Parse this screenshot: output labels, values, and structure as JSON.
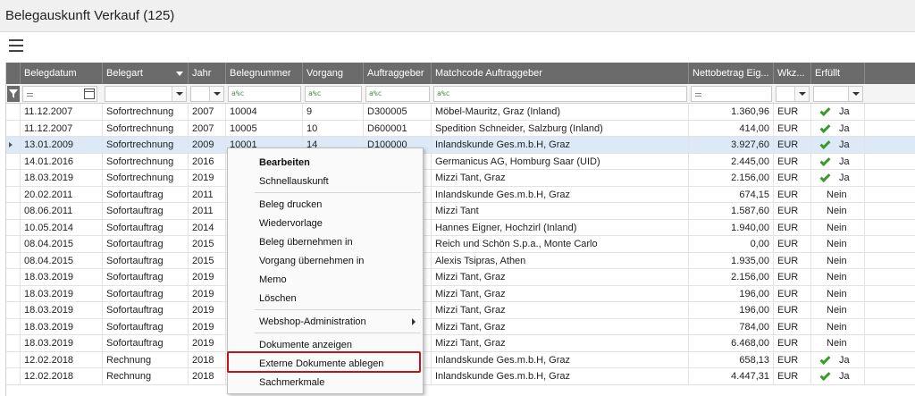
{
  "window": {
    "title": "Belegauskunft Verkauf (125)"
  },
  "colors": {
    "header_bg": "#6b6b6b",
    "selected_row": "#dde9f7",
    "check": "#3a9a2a",
    "highlight": "#c0131b"
  },
  "columns": [
    "Belegdatum",
    "Belegart",
    "Jahr",
    "Belegnummer",
    "Vorgang",
    "Auftraggeber",
    "Matchcode Auftraggeber",
    "Nettobetrag Eig...",
    "Wkz...",
    "Erfüllt"
  ],
  "filters": {
    "text_op": "a%c"
  },
  "rows": [
    {
      "datum": "11.12.2007",
      "art": "Sofortrechnung",
      "jahr": "2007",
      "nr": "10004",
      "vorgang": "9",
      "auftraggeber": "D300005",
      "matchcode": "Möbel-Mauritz, Graz (Inland)",
      "betrag": "1.360,96",
      "wkz": "EUR",
      "erfuellt": "Ja",
      "check": true
    },
    {
      "datum": "11.12.2007",
      "art": "Sofortrechnung",
      "jahr": "2007",
      "nr": "10005",
      "vorgang": "10",
      "auftraggeber": "D600001",
      "matchcode": "Spedition Schneider, Salzburg (Inland)",
      "betrag": "414,00",
      "wkz": "EUR",
      "erfuellt": "Ja",
      "check": true
    },
    {
      "datum": "13.01.2009",
      "art": "Sofortrechnung",
      "jahr": "2009",
      "nr": "10001",
      "vorgang": "14",
      "auftraggeber": "D100000",
      "matchcode": "Inlandskunde Ges.m.b.H, Graz",
      "betrag": "3.927,60",
      "wkz": "EUR",
      "erfuellt": "Ja",
      "check": true
    },
    {
      "datum": "14.01.2016",
      "art": "Sofortrechnung",
      "jahr": "2016",
      "nr": "",
      "vorgang": "",
      "auftraggeber": "",
      "matchcode": "Germanicus AG, Homburg Saar (UID)",
      "betrag": "2.445,00",
      "wkz": "EUR",
      "erfuellt": "Ja",
      "check": true
    },
    {
      "datum": "18.03.2019",
      "art": "Sofortrechnung",
      "jahr": "2019",
      "nr": "",
      "vorgang": "",
      "auftraggeber": "",
      "matchcode": "Mizzi Tant, Graz",
      "betrag": "2.156,00",
      "wkz": "EUR",
      "erfuellt": "Ja",
      "check": true
    },
    {
      "datum": "20.02.2011",
      "art": "Sofortauftrag",
      "jahr": "2011",
      "nr": "",
      "vorgang": "",
      "auftraggeber": "",
      "matchcode": "Inlandskunde Ges.m.b.H, Graz",
      "betrag": "674,15",
      "wkz": "EUR",
      "erfuellt": "Nein",
      "check": false
    },
    {
      "datum": "08.06.2011",
      "art": "Sofortauftrag",
      "jahr": "2011",
      "nr": "",
      "vorgang": "",
      "auftraggeber": "",
      "matchcode": "Mizzi Tant",
      "betrag": "1.587,60",
      "wkz": "EUR",
      "erfuellt": "Nein",
      "check": false
    },
    {
      "datum": "10.05.2014",
      "art": "Sofortauftrag",
      "jahr": "2014",
      "nr": "",
      "vorgang": "",
      "auftraggeber": "",
      "matchcode": "Hannes Eigner, Hochzirl (Inland)",
      "betrag": "1.940,00",
      "wkz": "EUR",
      "erfuellt": "Nein",
      "check": false
    },
    {
      "datum": "08.04.2015",
      "art": "Sofortauftrag",
      "jahr": "2015",
      "nr": "",
      "vorgang": "",
      "auftraggeber": "",
      "matchcode": "Reich und Schön S.p.a., Monte Carlo",
      "betrag": "0,00",
      "wkz": "EUR",
      "erfuellt": "Nein",
      "check": false
    },
    {
      "datum": "08.04.2015",
      "art": "Sofortauftrag",
      "jahr": "2015",
      "nr": "",
      "vorgang": "",
      "auftraggeber": "",
      "matchcode": "Alexis Tsipras, Athen",
      "betrag": "1.935,00",
      "wkz": "EUR",
      "erfuellt": "Nein",
      "check": false
    },
    {
      "datum": "18.03.2019",
      "art": "Sofortauftrag",
      "jahr": "2019",
      "nr": "",
      "vorgang": "",
      "auftraggeber": "",
      "matchcode": "Mizzi Tant, Graz",
      "betrag": "2.156,00",
      "wkz": "EUR",
      "erfuellt": "Nein",
      "check": false
    },
    {
      "datum": "18.03.2019",
      "art": "Sofortauftrag",
      "jahr": "2019",
      "nr": "",
      "vorgang": "",
      "auftraggeber": "",
      "matchcode": "Mizzi Tant, Graz",
      "betrag": "196,00",
      "wkz": "EUR",
      "erfuellt": "Nein",
      "check": false
    },
    {
      "datum": "18.03.2019",
      "art": "Sofortauftrag",
      "jahr": "2019",
      "nr": "",
      "vorgang": "",
      "auftraggeber": "",
      "matchcode": "Mizzi Tant, Graz",
      "betrag": "196,00",
      "wkz": "EUR",
      "erfuellt": "Nein",
      "check": false
    },
    {
      "datum": "18.03.2019",
      "art": "Sofortauftrag",
      "jahr": "2019",
      "nr": "",
      "vorgang": "",
      "auftraggeber": "",
      "matchcode": "Mizzi Tant, Graz",
      "betrag": "784,00",
      "wkz": "EUR",
      "erfuellt": "Nein",
      "check": false
    },
    {
      "datum": "18.03.2019",
      "art": "Sofortauftrag",
      "jahr": "2019",
      "nr": "",
      "vorgang": "",
      "auftraggeber": "",
      "matchcode": "Mizzi Tant, Graz",
      "betrag": "6.468,00",
      "wkz": "EUR",
      "erfuellt": "Nein",
      "check": false
    },
    {
      "datum": "12.02.2018",
      "art": "Rechnung",
      "jahr": "2018",
      "nr": "",
      "vorgang": "",
      "auftraggeber": "",
      "matchcode": "Inlandskunde Ges.m.b.H, Graz",
      "betrag": "658,13",
      "wkz": "EUR",
      "erfuellt": "Ja",
      "check": true
    },
    {
      "datum": "12.02.2018",
      "art": "Rechnung",
      "jahr": "2018",
      "nr": "",
      "vorgang": "",
      "auftraggeber": "",
      "matchcode": "Inlandskunde Ges.m.b.H, Graz",
      "betrag": "4.447,31",
      "wkz": "EUR",
      "erfuellt": "Ja",
      "check": true
    }
  ],
  "context_menu": {
    "bearbeiten": "Bearbeiten",
    "schnellauskunft": "Schnellauskunft",
    "beleg_drucken": "Beleg drucken",
    "wiedervorlage": "Wiedervorlage",
    "beleg_uebernehmen": "Beleg übernehmen in",
    "vorgang_uebernehmen": "Vorgang übernehmen in",
    "memo": "Memo",
    "loeschen": "Löschen",
    "webshop": "Webshop-Administration",
    "dokumente_anzeigen": "Dokumente anzeigen",
    "externe_dokumente": "Externe Dokumente ablegen",
    "sachmerkmale": "Sachmerkmale"
  }
}
